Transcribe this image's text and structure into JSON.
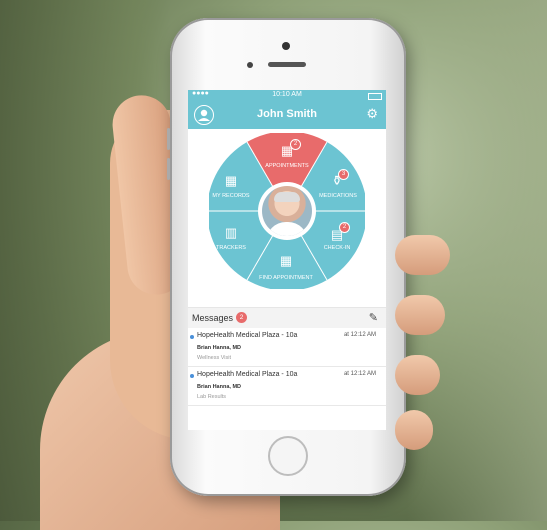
{
  "status_bar": {
    "signal": "●●●●",
    "time": "10:10 AM"
  },
  "header": {
    "title": "John Smith"
  },
  "wheel": {
    "segments": [
      {
        "label": "APPOINTMENTS",
        "badge": "2",
        "icon": "calendar-icon"
      },
      {
        "label": "MEDICATIONS",
        "badge": "3",
        "icon": "pill-bottle-icon"
      },
      {
        "label": "CHECK-IN",
        "badge": "2",
        "icon": "id-card-icon"
      },
      {
        "label": "FIND APPOINTMENT",
        "icon": "calendar-search-icon"
      },
      {
        "label": "TRACKERS",
        "icon": "chart-icon"
      },
      {
        "label": "MY RECORDS",
        "icon": "building-icon"
      }
    ],
    "colors": {
      "primary": "#6cc4d2",
      "accent": "#e86b6b"
    }
  },
  "messages": {
    "title": "Messages",
    "count": "2",
    "items": [
      {
        "subject": "HopeHealth Medical Plaza - 10a",
        "time": "at 12:12 AM",
        "from": "Brian Hanna, MD",
        "desc": "Wellness Visit"
      },
      {
        "subject": "HopeHealth Medical Plaza - 10a",
        "time": "at 12:12 AM",
        "from": "Brian Hanna, MD",
        "desc": "Lab Results"
      }
    ]
  }
}
